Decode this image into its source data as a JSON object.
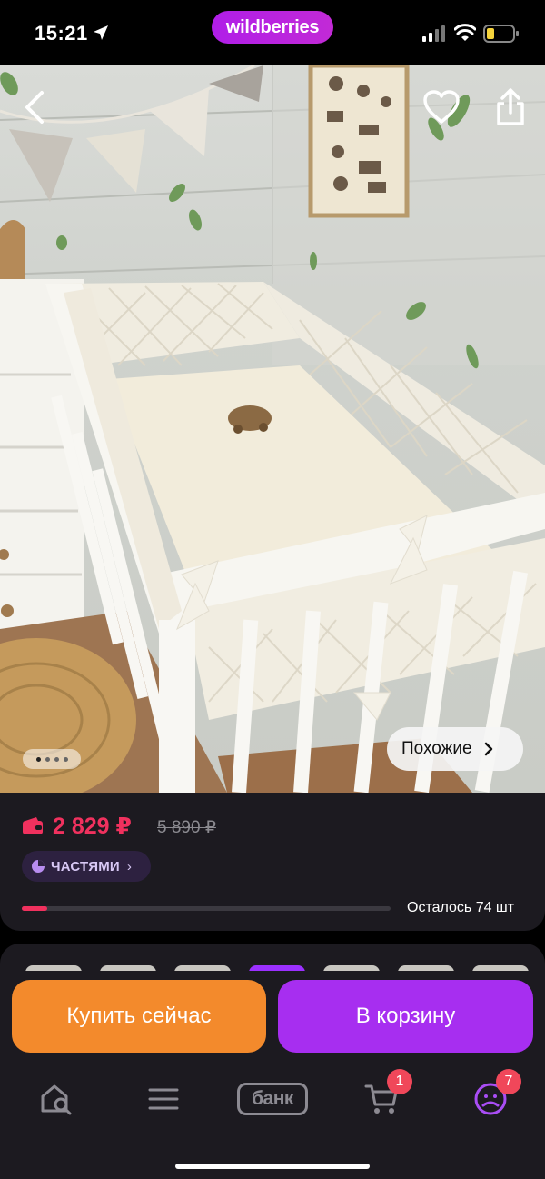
{
  "status_bar": {
    "time": "15:21",
    "brand": "wildberries"
  },
  "gallery": {
    "similar_label": "Похожие",
    "dots_total": 4,
    "dots_active": 0
  },
  "product": {
    "price": "2 829 ₽",
    "old_price": "5 890 ₽",
    "installments_label": "ЧАСТЯМИ",
    "stock_text": "Осталось 74 шт",
    "stock_fraction": 0.07
  },
  "actions": {
    "buy_now_label": "Купить сейчас",
    "add_to_cart_label": "В корзину"
  },
  "tabbar": {
    "bank_label": "банк",
    "cart_badge": "1",
    "profile_badge": "7"
  },
  "colors": {
    "brand": "#b01ee8",
    "price": "#f0315e",
    "buy_now": "#f38a2c",
    "add_to_cart": "#a72ef0"
  }
}
